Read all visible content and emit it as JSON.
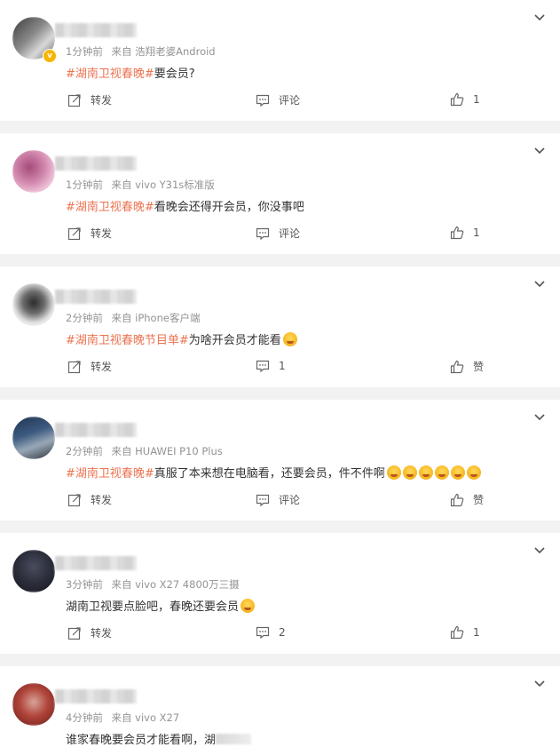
{
  "ui": {
    "repost_label": "转发",
    "comment_label": "评论",
    "like_label": "赞",
    "icons": {
      "repost": "repost-icon",
      "comment": "comment-icon",
      "like": "thumbs-up-icon",
      "more": "chevron-down-icon"
    },
    "colors": {
      "topic": "#eb7350",
      "meta": "#939393",
      "text": "#333333"
    }
  },
  "posts": [
    {
      "time": "1分钟前",
      "source": "来自 浩翔老婆Android",
      "topic": "#湖南卫视春晚#",
      "text": "要会员?",
      "emoji_count": 0,
      "comment": "评论",
      "like": "1",
      "verified": true
    },
    {
      "time": "1分钟前",
      "source": "来自 vivo Y31s标准版",
      "topic": "#湖南卫视春晚#",
      "text": "看晚会还得开会员，你没事吧",
      "emoji_count": 0,
      "comment": "评论",
      "like": "1"
    },
    {
      "time": "2分钟前",
      "source": "来自 iPhone客户端",
      "topic": "#湖南卫视春晚节目单#",
      "text": "为啥开会员才能看",
      "emoji_count": 1,
      "comment": "1",
      "like": "赞"
    },
    {
      "time": "2分钟前",
      "source": "来自 HUAWEI P10 Plus",
      "topic": "#湖南卫视春晚#",
      "text": "真服了本来想在电脑看，还要会员，件不件啊",
      "emoji_count": 6,
      "comment": "评论",
      "like": "赞"
    },
    {
      "time": "3分钟前",
      "source": "来自 vivo X27 4800万三摄",
      "topic": "",
      "text": "湖南卫视要点脸吧，春晚还要会员",
      "emoji_count": 1,
      "comment": "2",
      "like": "1"
    },
    {
      "time": "4分钟前",
      "source": "来自 vivo X27",
      "topic": "",
      "text": "谁家春晚要会员才能看啊，湖",
      "emoji_count": 0,
      "comment": "",
      "like": "",
      "truncated": true
    }
  ]
}
